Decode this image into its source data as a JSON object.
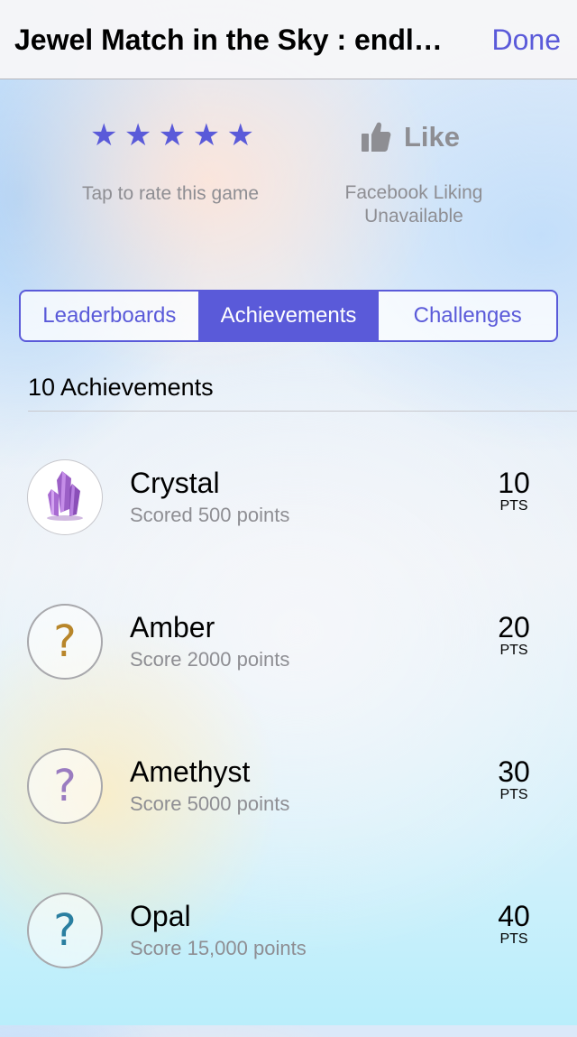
{
  "nav": {
    "title": "Jewel Match in the Sky : endl…",
    "done_label": "Done"
  },
  "rating": {
    "stars": [
      "★",
      "★",
      "★",
      "★",
      "★"
    ],
    "label": "Tap to rate this game"
  },
  "like": {
    "icon": "thumbs-up-icon",
    "label": "Like",
    "status": "Facebook Liking Unavailable"
  },
  "tabs": [
    {
      "label": "Leaderboards",
      "active": false
    },
    {
      "label": "Achievements",
      "active": true
    },
    {
      "label": "Challenges",
      "active": false
    }
  ],
  "achievements_header": "10 Achievements",
  "achievements": [
    {
      "name": "Crystal",
      "description": "Scored 500 points",
      "points": "10",
      "unit": "PTS",
      "earned": true,
      "icon": "crystal-icon"
    },
    {
      "name": "Amber",
      "description": "Score 2000 points",
      "points": "20",
      "unit": "PTS",
      "earned": false,
      "mark": "?",
      "mark_color": "#b8862a"
    },
    {
      "name": "Amethyst",
      "description": "Score 5000 points",
      "points": "30",
      "unit": "PTS",
      "earned": false,
      "mark": "?",
      "mark_color": "#9a7cc0"
    },
    {
      "name": "Opal",
      "description": "Score 15,000 points",
      "points": "40",
      "unit": "PTS",
      "earned": false,
      "mark": "?",
      "mark_color": "#2a7fa0"
    }
  ],
  "colors": {
    "accent": "#5a5ad9",
    "secondary_text": "#8e8e93"
  }
}
